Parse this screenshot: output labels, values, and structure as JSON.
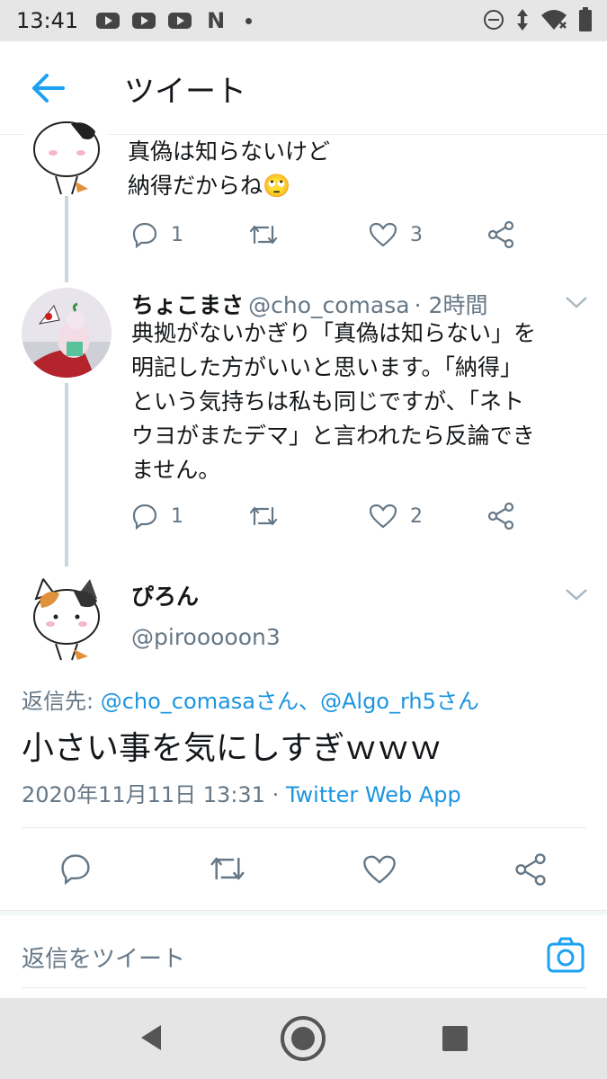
{
  "status_bar": {
    "time": "13:41",
    "app_icons": [
      "youtube-icon",
      "youtube-icon",
      "youtube-icon",
      "netflix-icon"
    ],
    "netflix_letter": "N",
    "right_icons": [
      "do-not-disturb-icon",
      "data-arrows-icon",
      "wifi-icon",
      "battery-icon"
    ]
  },
  "header": {
    "title": "ツイート"
  },
  "tweets": [
    {
      "text_lines": [
        "真偽は知らないけど",
        "納得だからね🙄"
      ],
      "reply_count": "1",
      "like_count": "3"
    },
    {
      "name": "ちょこまさ",
      "handle": "@cho_comasa",
      "time": "· 2時間",
      "text_lines": [
        "典拠がないかぎり「真偽は知らない」を",
        "明記した方がいいと思います。「納得」",
        "という気持ちは私も同じですが、「ネト",
        "ウヨがまたデマ」と言われたら反論でき",
        "ません。"
      ],
      "reply_count": "1",
      "like_count": "2"
    }
  ],
  "main_tweet": {
    "name": "ぴろん",
    "handle": "@pirooooon3",
    "reply_to_prefix": "返信先: ",
    "reply_to_users": "@cho_comasaさん、@Algo_rh5さん",
    "text": "小さい事を気にしすぎｗｗｗ",
    "datetime": "2020年11月11日 13:31 · ",
    "source": "Twitter Web App"
  },
  "compose": {
    "placeholder": "返信をツイート"
  },
  "colors": {
    "accent": "#1da1f2",
    "link": "#1b95e0",
    "muted": "#657786",
    "text": "#14171a"
  }
}
